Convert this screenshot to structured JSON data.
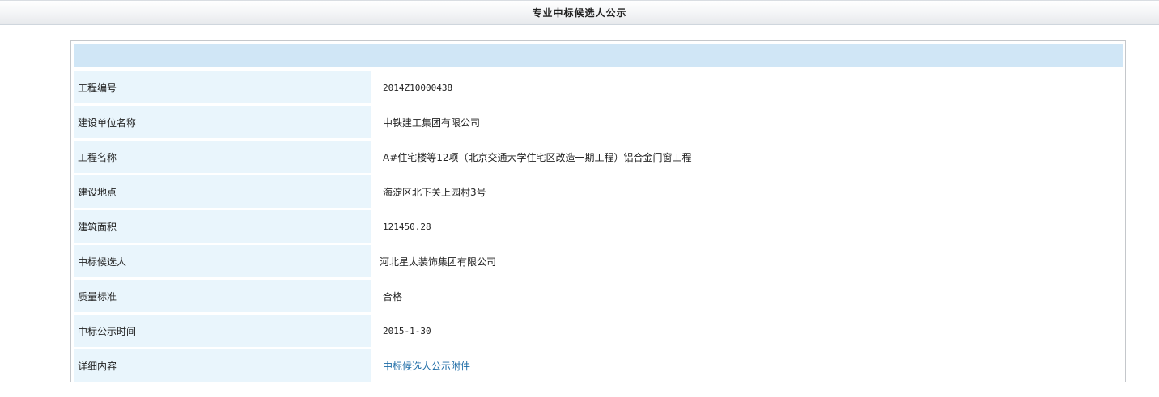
{
  "page": {
    "title": "专业中标候选人公示"
  },
  "details": {
    "rows": [
      {
        "label": "工程编号",
        "value": "2014Z10000438"
      },
      {
        "label": "建设单位名称",
        "value": "中铁建工集团有限公司"
      },
      {
        "label": "工程名称",
        "value": "A#住宅楼等12项（北京交通大学住宅区改造一期工程）铝合金门窗工程"
      },
      {
        "label": "建设地点",
        "value": "海淀区北下关上园村3号"
      },
      {
        "label": "建筑面积",
        "value": "121450.28"
      },
      {
        "label": "中标候选人",
        "value": "河北星太装饰集团有限公司"
      },
      {
        "label": "质量标准",
        "value": "合格"
      },
      {
        "label": "中标公示时间",
        "value": "2015-1-30"
      },
      {
        "label": "详细内容",
        "value": "中标候选人公示附件"
      }
    ]
  },
  "colors": {
    "band": "#d0e6f6",
    "label_background": "#e9f5fc",
    "link": "#1b6aa5",
    "border": "#c4c7cb"
  }
}
